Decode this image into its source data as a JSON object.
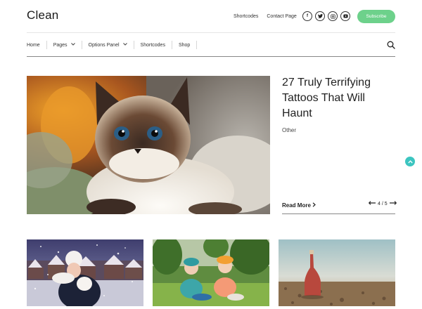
{
  "site": {
    "logo": "Clean"
  },
  "top_links": [
    "Shortcodes",
    "Contact Page"
  ],
  "socials": [
    {
      "icon": "facebook-icon",
      "glyph": "f"
    },
    {
      "icon": "twitter-icon",
      "glyph": "t"
    },
    {
      "icon": "instagram-icon",
      "glyph": "◎"
    },
    {
      "icon": "youtube-icon",
      "glyph": "▶"
    }
  ],
  "subscribe_label": "Subscribe",
  "nav": {
    "items": [
      {
        "label": "Home",
        "dropdown": false
      },
      {
        "label": "Pages",
        "dropdown": true
      },
      {
        "label": "Options Panel",
        "dropdown": true
      },
      {
        "label": "Shortcodes",
        "dropdown": false
      },
      {
        "label": "Shop",
        "dropdown": false
      }
    ]
  },
  "feature": {
    "title": "27 Truly Terrifying Tattoos That Will Haunt",
    "category": "Other",
    "read_more": "Read More",
    "pager": "4 / 5"
  },
  "colors": {
    "accent_green": "#6dd18b",
    "accent_teal": "#3cc5c0"
  }
}
